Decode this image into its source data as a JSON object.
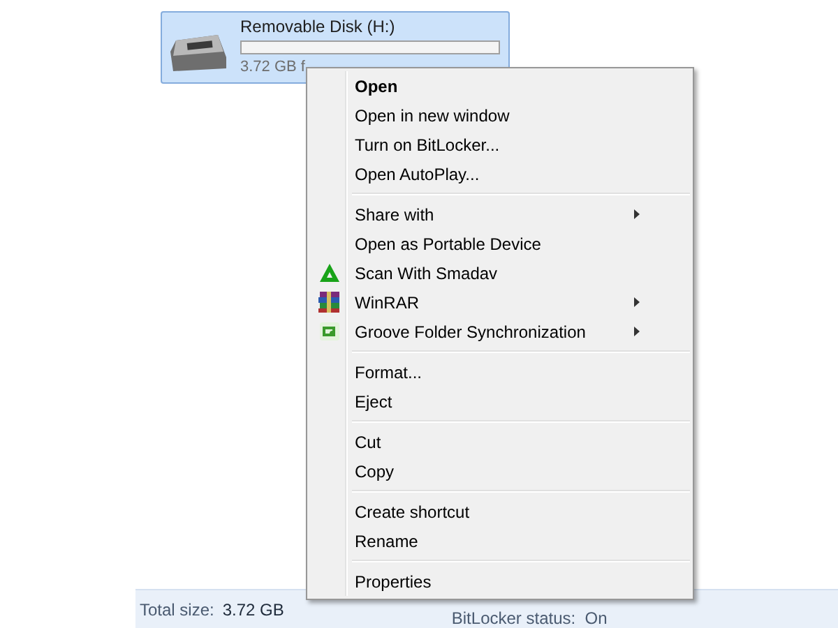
{
  "drive": {
    "name": "Removable Disk (H:)",
    "free_text": "3.72 GB f",
    "selected": true
  },
  "context_menu": {
    "groups": [
      [
        {
          "label": "Open",
          "bold": true,
          "submenu": false
        },
        {
          "label": "Open in new window",
          "bold": false,
          "submenu": false
        },
        {
          "label": "Turn on BitLocker...",
          "bold": false,
          "submenu": false
        },
        {
          "label": "Open AutoPlay...",
          "bold": false,
          "submenu": false
        }
      ],
      [
        {
          "label": "Share with",
          "bold": false,
          "submenu": true
        },
        {
          "label": "Open as Portable Device",
          "bold": false,
          "submenu": false
        },
        {
          "label": "Scan With Smadav",
          "bold": false,
          "submenu": false,
          "kind": "triangle"
        },
        {
          "label": "WinRAR",
          "bold": false,
          "submenu": true,
          "kind": "books"
        },
        {
          "label": "Groove Folder Synchronization",
          "bold": false,
          "submenu": true,
          "kind": "sync"
        }
      ],
      [
        {
          "label": "Format...",
          "bold": false,
          "submenu": false
        },
        {
          "label": "Eject",
          "bold": false,
          "submenu": false
        }
      ],
      [
        {
          "label": "Cut",
          "bold": false,
          "submenu": false
        },
        {
          "label": "Copy",
          "bold": false,
          "submenu": false
        }
      ],
      [
        {
          "label": "Create shortcut",
          "bold": false,
          "submenu": false
        },
        {
          "label": "Rename",
          "bold": false,
          "submenu": false
        }
      ],
      [
        {
          "label": "Properties",
          "bold": false,
          "submenu": false
        }
      ]
    ]
  },
  "status_bar": {
    "total_label": "Total size:",
    "total_value": "3.72 GB",
    "bitlocker": "BitLocker status:  On"
  }
}
